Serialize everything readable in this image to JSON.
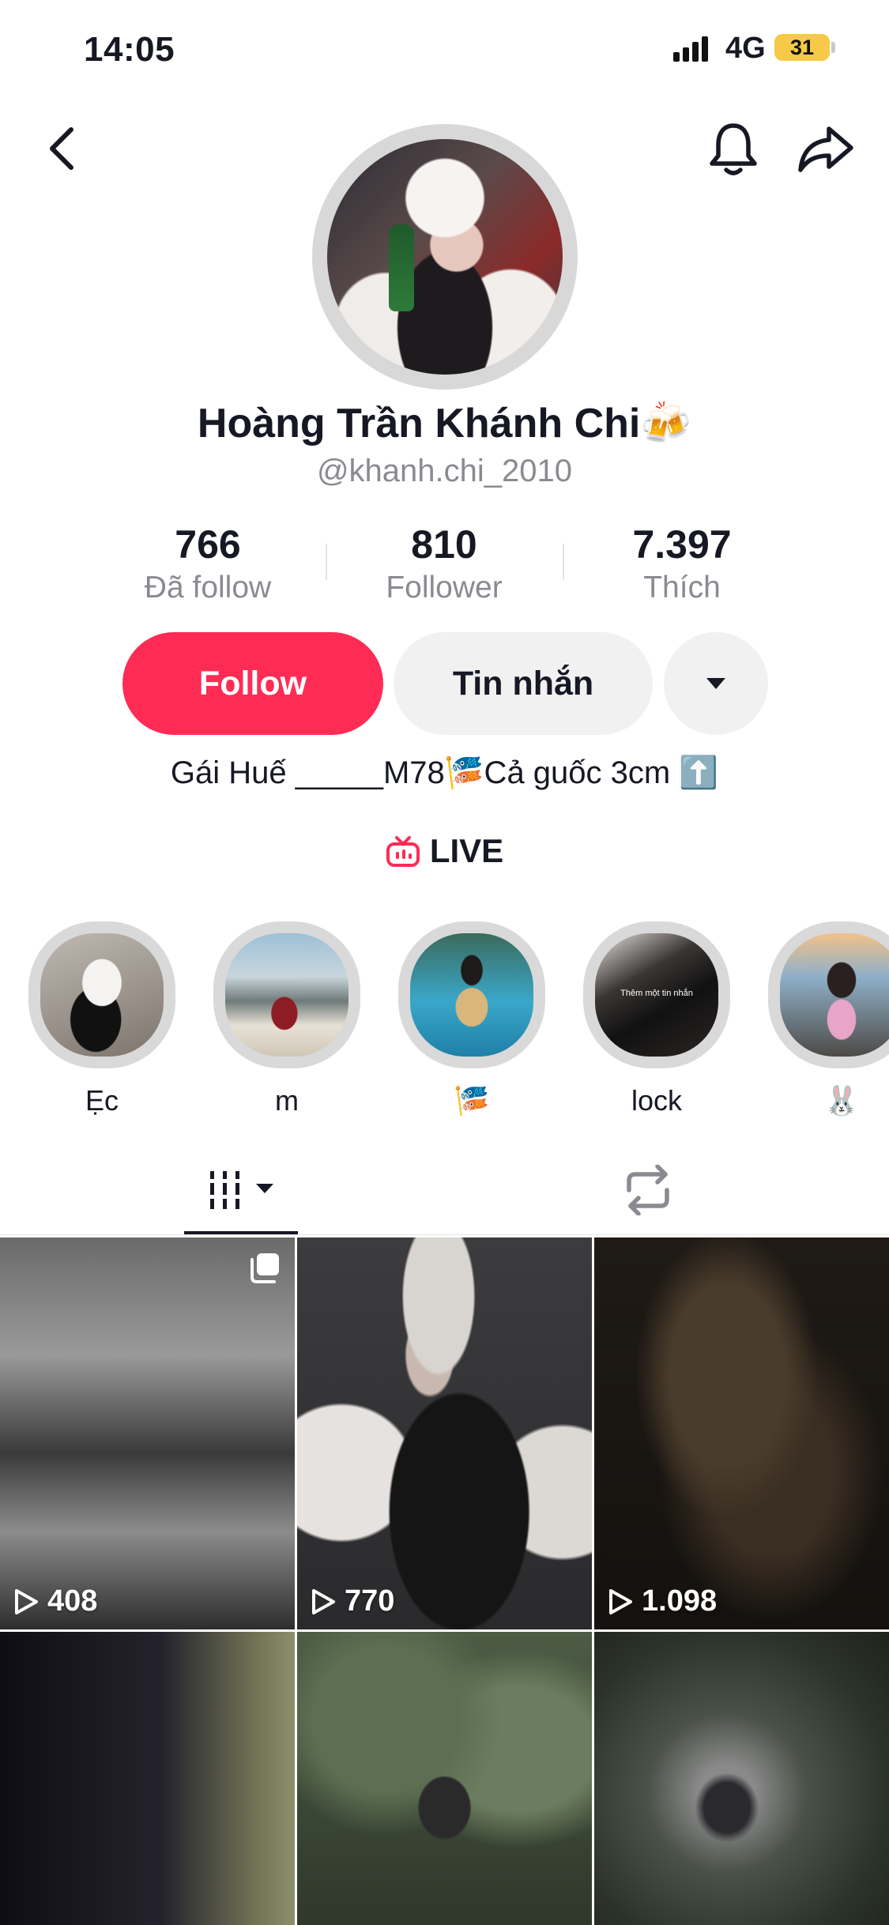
{
  "status_bar": {
    "time": "14:05",
    "network": "4G",
    "battery": "31"
  },
  "profile": {
    "name": "Hoàng Trần Khánh Chi",
    "name_emoji": "🍻",
    "handle": "@khanh.chi_2010",
    "bio": "Gái Huế _____M78🎏Cả guốc 3cm ⬆️"
  },
  "stats": [
    {
      "value": "766",
      "label": "Đã follow"
    },
    {
      "value": "810",
      "label": "Follower"
    },
    {
      "value": "7.397",
      "label": "Thích"
    }
  ],
  "actions": {
    "follow": "Follow",
    "message": "Tin nhắn"
  },
  "live_label": "LIVE",
  "highlights": [
    {
      "label": "Ẹc"
    },
    {
      "label": "m"
    },
    {
      "label": "🎏"
    },
    {
      "label": "lock"
    },
    {
      "label": "🐰"
    }
  ],
  "highlight_overlay_text": "Thêm một tin nhắn",
  "videos": [
    {
      "views": "408"
    },
    {
      "views": "770"
    },
    {
      "views": "1.098"
    },
    {
      "views": ""
    },
    {
      "views": ""
    },
    {
      "views": ""
    }
  ],
  "colors": {
    "accent": "#fe2c55",
    "text": "#161823",
    "muted": "#8a8b91"
  }
}
